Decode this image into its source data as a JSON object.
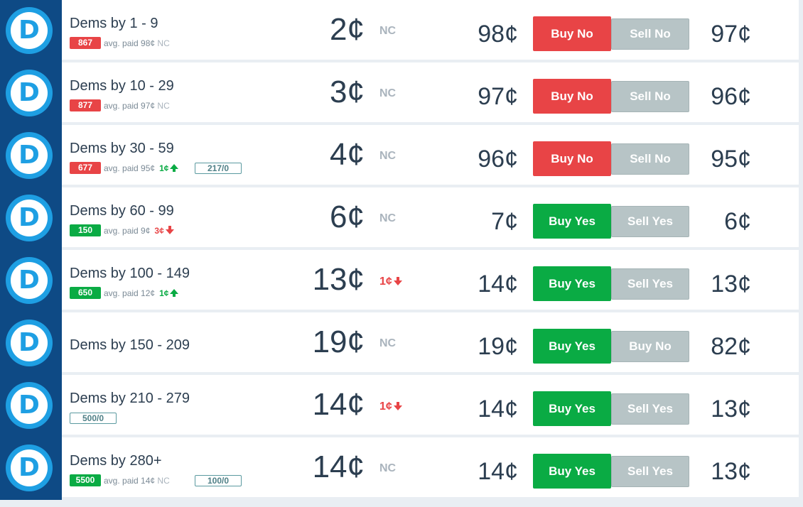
{
  "rows": [
    {
      "name": "Dems by 1 - 9",
      "shares": "867",
      "shares_color": "red",
      "avg": "avg. paid 98¢",
      "avg_nc": "NC",
      "change": "",
      "change_dir": "",
      "position": "",
      "price": "2¢",
      "delta": "NC",
      "delta_dir": "",
      "offer": "98¢",
      "buy_label": "Buy No",
      "buy_color": "red",
      "sell_label": "Sell No",
      "last": "97¢"
    },
    {
      "name": "Dems by 10 - 29",
      "shares": "877",
      "shares_color": "red",
      "avg": "avg. paid 97¢",
      "avg_nc": "NC",
      "change": "",
      "change_dir": "",
      "position": "",
      "price": "3¢",
      "delta": "NC",
      "delta_dir": "",
      "offer": "97¢",
      "buy_label": "Buy No",
      "buy_color": "red",
      "sell_label": "Sell No",
      "last": "96¢"
    },
    {
      "name": "Dems by 30 - 59",
      "shares": "677",
      "shares_color": "red",
      "avg": "avg. paid 95¢",
      "avg_nc": "",
      "change": "1¢",
      "change_dir": "up",
      "position": "217/0",
      "price": "4¢",
      "delta": "NC",
      "delta_dir": "",
      "offer": "96¢",
      "buy_label": "Buy No",
      "buy_color": "red",
      "sell_label": "Sell No",
      "last": "95¢"
    },
    {
      "name": "Dems by 60 - 99",
      "shares": "150",
      "shares_color": "green",
      "avg": "avg. paid 9¢",
      "avg_nc": "",
      "change": "3¢",
      "change_dir": "down",
      "position": "",
      "price": "6¢",
      "delta": "NC",
      "delta_dir": "",
      "offer": "7¢",
      "buy_label": "Buy Yes",
      "buy_color": "green",
      "sell_label": "Sell Yes",
      "last": "6¢"
    },
    {
      "name": "Dems by 100 - 149",
      "shares": "650",
      "shares_color": "green",
      "avg": "avg. paid 12¢",
      "avg_nc": "",
      "change": "1¢",
      "change_dir": "up",
      "position": "",
      "price": "13¢",
      "delta": "1¢",
      "delta_dir": "down",
      "offer": "14¢",
      "buy_label": "Buy Yes",
      "buy_color": "green",
      "sell_label": "Sell Yes",
      "last": "13¢"
    },
    {
      "name": "Dems by 150 - 209",
      "shares": "",
      "shares_color": "",
      "avg": "",
      "avg_nc": "",
      "change": "",
      "change_dir": "",
      "position": "",
      "price": "19¢",
      "delta": "NC",
      "delta_dir": "",
      "offer": "19¢",
      "buy_label": "Buy Yes",
      "buy_color": "green",
      "sell_label": "Buy No",
      "last": "82¢"
    },
    {
      "name": "Dems by 210 - 279",
      "shares": "",
      "shares_color": "",
      "avg": "",
      "avg_nc": "",
      "change": "",
      "change_dir": "",
      "position": "500/0",
      "price": "14¢",
      "delta": "1¢",
      "delta_dir": "down",
      "offer": "14¢",
      "buy_label": "Buy Yes",
      "buy_color": "green",
      "sell_label": "Sell Yes",
      "last": "13¢"
    },
    {
      "name": "Dems by 280+",
      "shares": "5500",
      "shares_color": "green",
      "avg": "avg. paid 14¢",
      "avg_nc": "NC",
      "change": "",
      "change_dir": "",
      "position": "100/0",
      "price": "14¢",
      "delta": "NC",
      "delta_dir": "",
      "offer": "14¢",
      "buy_label": "Buy Yes",
      "buy_color": "green",
      "sell_label": "Sell Yes",
      "last": "13¢"
    }
  ],
  "logo_letter": "D",
  "colors": {
    "sidebar": "#0e4a85",
    "logo": "#1e9fe3",
    "red": "#e84446",
    "green": "#0aab44",
    "sell": "#b7c4c6"
  }
}
